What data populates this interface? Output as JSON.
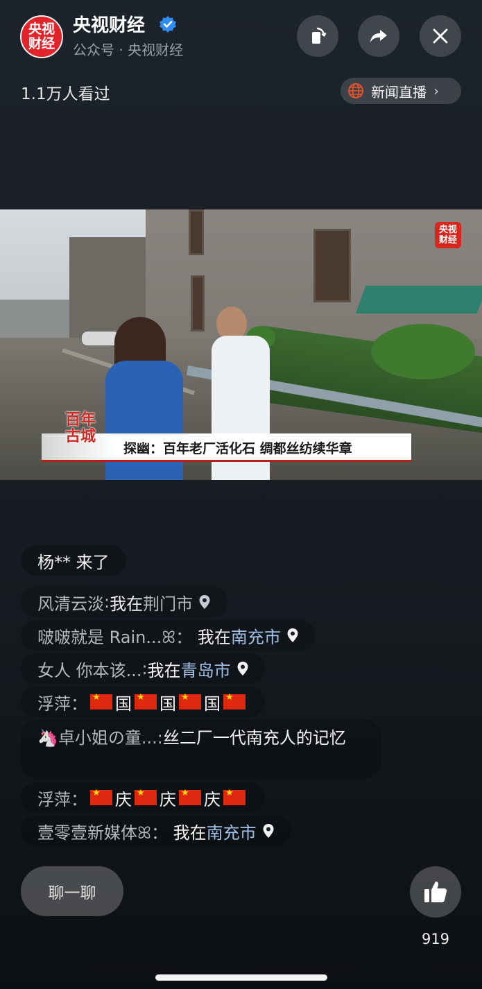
{
  "header": {
    "logo_text": "央视财经",
    "account_name": "央视财经",
    "account_sub": "公众号 · 央视财经",
    "views": "1.1万人看过",
    "news_live_label": "新闻直播",
    "icons": [
      "rotate-screen-icon",
      "share-icon",
      "close-icon"
    ]
  },
  "video": {
    "watermark": "央视财经",
    "show_logo": "百年古城",
    "caption": "探幽：百年老厂活化石  绸都丝纺续华章"
  },
  "comments": {
    "joined": "杨** 来了",
    "c1": {
      "user": "风清云淡",
      "sep": ":",
      "text": "我在",
      "loc": "荆门市"
    },
    "c2": {
      "user": "啵啵就是 Rain...",
      "sep": "ꕤ：",
      "text": "我在",
      "loc": "南充市"
    },
    "c3": {
      "user": "女人 你本该...",
      "sep": ":",
      "text": "我在",
      "loc": "青岛市"
    },
    "c4": {
      "user": "浮萍",
      "sep": "：",
      "chars": [
        "国",
        "国",
        "国"
      ]
    },
    "c5": {
      "emoji": "🦄",
      "user": "卓小姐の童...",
      "sep": ":",
      "text": "丝二厂一代南充人的记忆"
    },
    "c6": {
      "user": "浮萍",
      "sep": "：",
      "chars": [
        "庆",
        "庆",
        "庆"
      ]
    },
    "c7": {
      "user": "壹零壹新媒体",
      "sep": "ꕤ：",
      "text": "我在",
      "loc": "南充市"
    }
  },
  "bottom": {
    "chat_label": "聊一聊",
    "like_count": "919"
  },
  "colors": {
    "accent_red": "#e0242a",
    "verified_blue": "#2f8cf0",
    "location_blue": "#9fc0e6"
  }
}
